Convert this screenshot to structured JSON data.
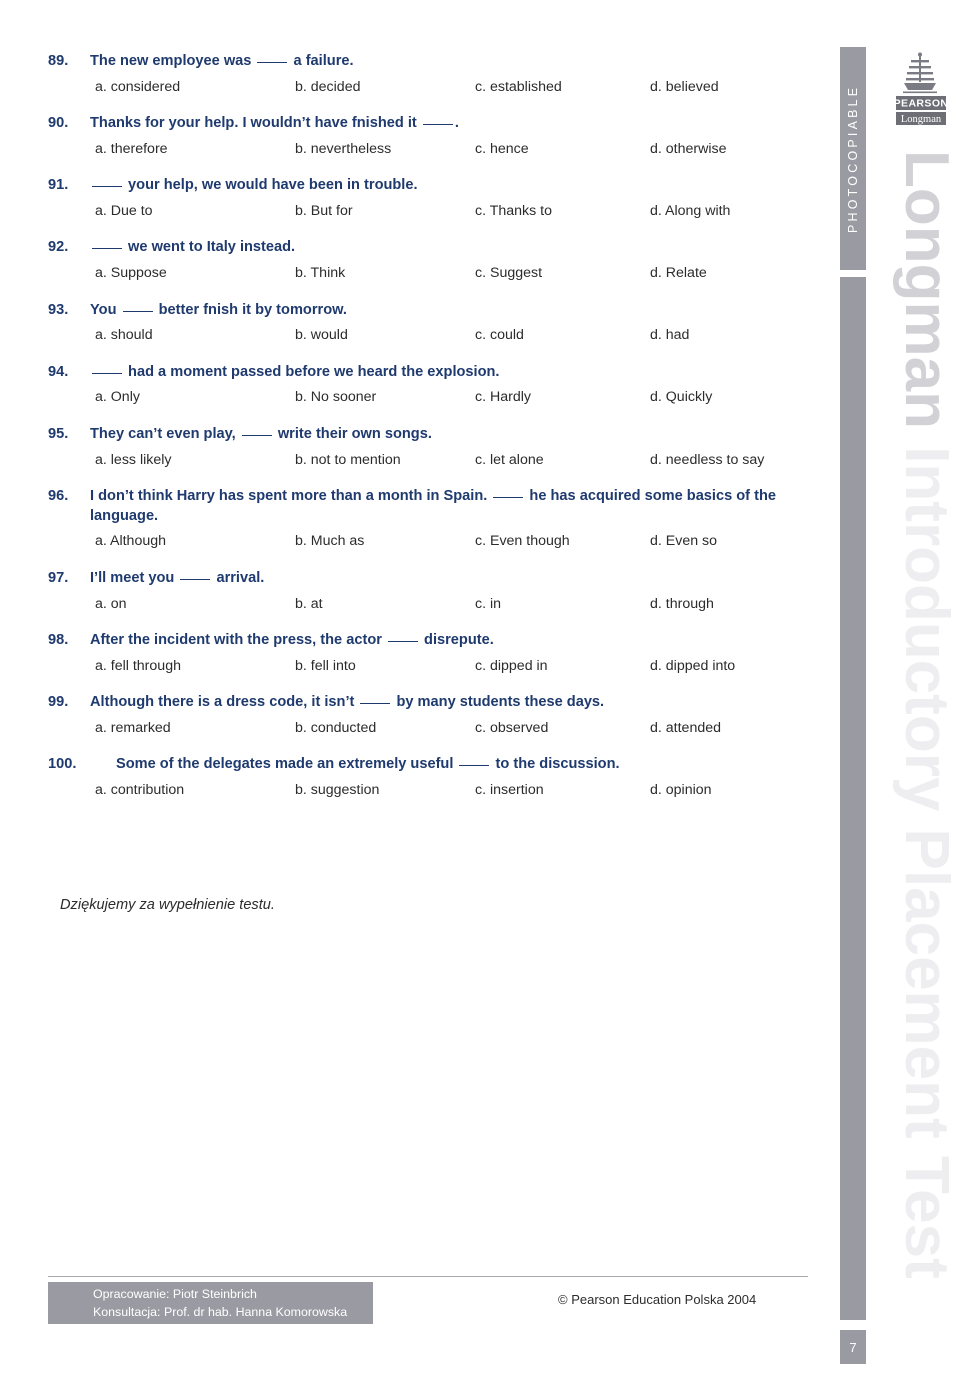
{
  "document": {
    "page_number": "7",
    "closing_note": "Dziękujemy za wypełnienie testu."
  },
  "sidebar": {
    "photocopiable_label": "PHOTOCOPIABLE",
    "watermark_brand": "Longman",
    "watermark_title": " Introductory Placement Test",
    "logo": {
      "name": "pearson-longman-logo",
      "primary_text": "PEARSON",
      "secondary_text": "Longman"
    }
  },
  "footer": {
    "credit_line_1": "Opracowanie: Piotr Steinbrich",
    "credit_line_2": "Konsultacja: Prof. dr hab. Hanna Komorowska",
    "copyright": "© Pearson Education Polska 2004"
  },
  "colors": {
    "question_blue": "#1f3a6e",
    "option_text": "#2c2c2c",
    "grey_bar": "#9a9aa2",
    "watermark_brand": "#d2d2d6",
    "watermark_title": "#eeeef0"
  },
  "questions": [
    {
      "number": "89.",
      "stem_before": "The new employee was ",
      "stem_after": " a failure.",
      "options": {
        "a": "a. considered",
        "b": "b. decided",
        "c": "c. established",
        "d": "d. believed"
      }
    },
    {
      "number": "90.",
      "stem_before": "Thanks for your help. I wouldn’t have fnished it ",
      "stem_after": ".",
      "options": {
        "a": "a. therefore",
        "b": "b. nevertheless",
        "c": "c. hence",
        "d": "d. otherwise"
      }
    },
    {
      "number": "91.",
      "stem_before": "",
      "stem_after": " your help, we would have been in trouble.",
      "options": {
        "a": "a. Due to",
        "b": "b. But for",
        "c": "c. Thanks to",
        "d": "d. Along with"
      }
    },
    {
      "number": "92.",
      "stem_before": "",
      "stem_after": " we went to Italy instead.",
      "options": {
        "a": "a. Suppose",
        "b": "b. Think",
        "c": "c. Suggest",
        "d": "d. Relate"
      }
    },
    {
      "number": "93.",
      "stem_before": "You ",
      "stem_after": " better fnish it by tomorrow.",
      "options": {
        "a": "a. should",
        "b": "b. would",
        "c": "c. could",
        "d": "d. had"
      }
    },
    {
      "number": "94.",
      "stem_before": "",
      "stem_after": " had a moment passed before we heard the explosion.",
      "options": {
        "a": "a. Only",
        "b": "b. No sooner",
        "c": "c. Hardly",
        "d": "d. Quickly"
      }
    },
    {
      "number": "95.",
      "stem_before": "They can’t even play, ",
      "stem_after": " write their own songs.",
      "options": {
        "a": "a. less likely",
        "b": "b. not to mention",
        "c": "c. let alone",
        "d": "d. needless to say"
      }
    },
    {
      "number": "96.",
      "stem_before": "I don’t think Harry has spent more than a month in Spain. ",
      "stem_after": " he has acquired some basics of the language.",
      "options": {
        "a": "a. Although",
        "b": "b. Much as",
        "c": "c. Even though",
        "d": "d. Even so"
      }
    },
    {
      "number": "97.",
      "stem_before": "I’ll meet you ",
      "stem_after": " arrival.",
      "options": {
        "a": "a. on",
        "b": "b. at",
        "c": "c. in",
        "d": "d. through"
      }
    },
    {
      "number": "98.",
      "stem_before": "After the incident with the press, the actor ",
      "stem_after": " disrepute.",
      "options": {
        "a": "a. fell through",
        "b": "b. fell into",
        "c": "c. dipped in",
        "d": "d. dipped into"
      }
    },
    {
      "number": "99.",
      "stem_before": "Although there is a dress code, it isn’t ",
      "stem_after": " by many students these days.",
      "options": {
        "a": "a. remarked",
        "b": "b. conducted",
        "c": "c. observed",
        "d": "d. attended"
      }
    },
    {
      "number": "100.",
      "stem_before": "Some of the delegates made an extremely useful ",
      "stem_after": " to the discussion.",
      "options": {
        "a": "a. contribution",
        "b": "b. suggestion",
        "c": "c. insertion",
        "d": "d. opinion"
      }
    }
  ]
}
